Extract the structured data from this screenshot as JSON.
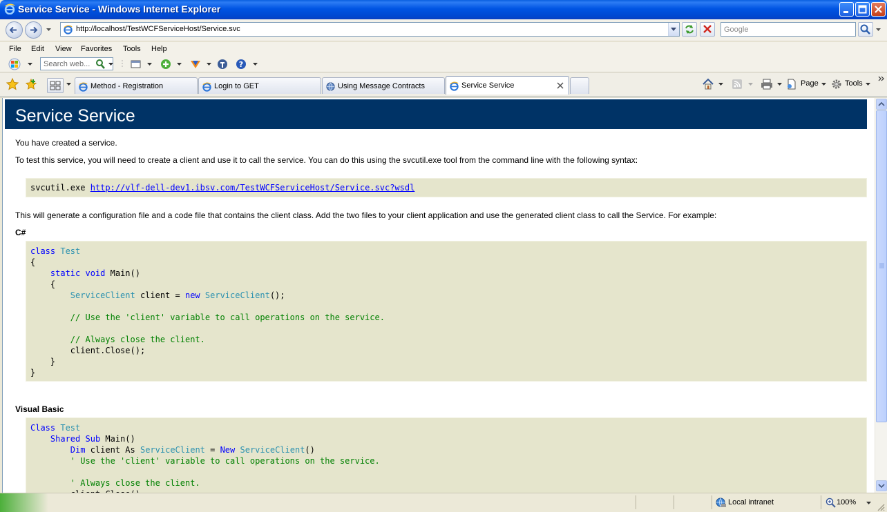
{
  "window": {
    "title": "Service Service - Windows Internet Explorer"
  },
  "address": {
    "url": "http://localhost/TestWCFServiceHost/Service.svc",
    "search_placeholder": "Google"
  },
  "menu": {
    "items": [
      "File",
      "Edit",
      "View",
      "Favorites",
      "Tools",
      "Help"
    ]
  },
  "search_toolbar": {
    "placeholder": "Search web..."
  },
  "tabs": [
    {
      "label": "Method - Registration",
      "active": false
    },
    {
      "label": "Login to GET",
      "active": false
    },
    {
      "label": "Using Message Contracts",
      "active": false
    },
    {
      "label": "Service Service",
      "active": true
    }
  ],
  "command_bar": {
    "page_label": "Page",
    "tools_label": "Tools"
  },
  "page": {
    "heading": "Service Service",
    "intro": "You have created a service.",
    "instructions": "To test this service, you will need to create a client and use it to call the service. You can do this using the svcutil.exe tool from the command line with the following syntax:",
    "svcutil_cmd": "svcutil.exe",
    "wsdl_link": "http://vlf-dell-dev1.ibsv.com/TestWCFServiceHost/Service.svc?wsdl",
    "generate_text": "This will generate a configuration file and a code file that contains the client class. Add the two files to your client application and use the generated client class to call the Service. For example:",
    "csharp_label": "C#",
    "vb_label": "Visual Basic"
  },
  "status": {
    "zone": "Local intranet",
    "zoom": "100%"
  },
  "colors": {
    "heading_bg": "#003366",
    "code_bg": "#e5e5cc",
    "keyword": "#0000ff",
    "type": "#2b91af",
    "comment": "#008000"
  }
}
